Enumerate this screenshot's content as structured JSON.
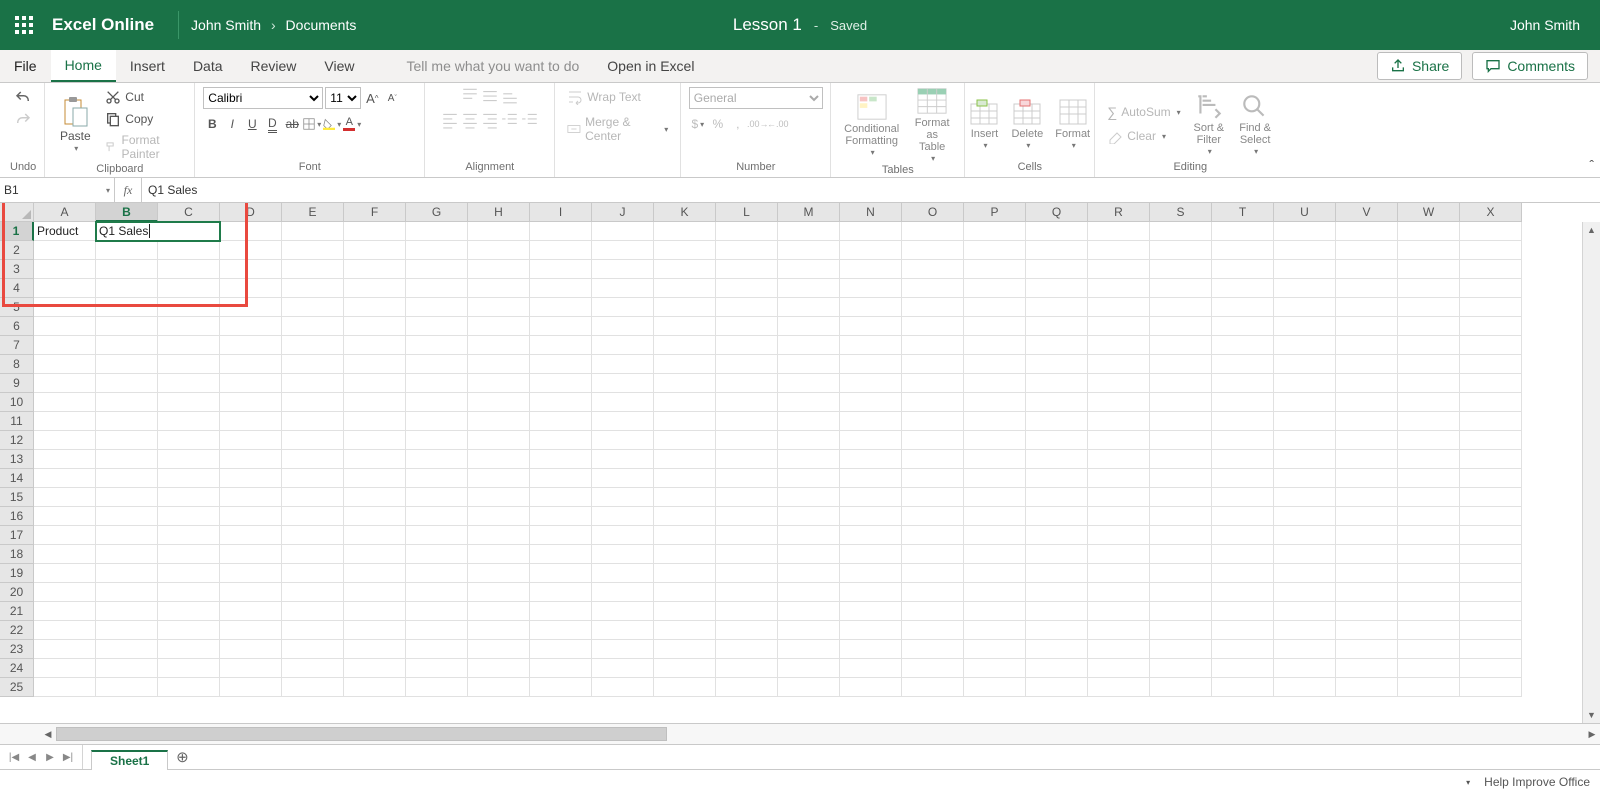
{
  "titlebar": {
    "app": "Excel Online",
    "user": "John Smith",
    "crumb_user": "John Smith",
    "crumb_loc": "Documents",
    "doc": "Lesson 1",
    "saved": "Saved",
    "right_user": "John Smith"
  },
  "tabs": {
    "file": "File",
    "home": "Home",
    "insert": "Insert",
    "data": "Data",
    "review": "Review",
    "view": "View",
    "tellme": "Tell me what you want to do",
    "open": "Open in Excel",
    "share": "Share",
    "comments": "Comments"
  },
  "ribbon": {
    "undo": "Undo",
    "clipboard": {
      "label": "Clipboard",
      "paste": "Paste",
      "cut": "Cut",
      "copy": "Copy",
      "painter": "Format Painter"
    },
    "font": {
      "label": "Font",
      "name": "Calibri",
      "size": "11"
    },
    "alignment": {
      "label": "Alignment",
      "wrap": "Wrap Text",
      "merge": "Merge & Center"
    },
    "number": {
      "label": "Number",
      "format": "General"
    },
    "tables": {
      "label": "Tables",
      "cond": "Conditional Formatting",
      "fmt": "Format as Table"
    },
    "cells": {
      "label": "Cells",
      "insert": "Insert",
      "delete": "Delete",
      "format": "Format"
    },
    "editing": {
      "label": "Editing",
      "autosum": "AutoSum",
      "clear": "Clear",
      "sort": "Sort & Filter",
      "find": "Find & Select"
    }
  },
  "fbar": {
    "name": "B1",
    "fx": "fx",
    "formula": "Q1 Sales"
  },
  "cells": {
    "A1": "Product",
    "B1": "Q1 Sales"
  },
  "columns": [
    "A",
    "B",
    "C",
    "D",
    "E",
    "F",
    "G",
    "H",
    "I",
    "J",
    "K",
    "L",
    "M",
    "N",
    "O",
    "P",
    "Q",
    "R",
    "S",
    "T",
    "U",
    "V",
    "W",
    "X"
  ],
  "row_count": 25,
  "active": {
    "col": "B",
    "row": 1
  },
  "sheets": {
    "sheet1": "Sheet1"
  },
  "status": {
    "help": "Help Improve Office"
  }
}
